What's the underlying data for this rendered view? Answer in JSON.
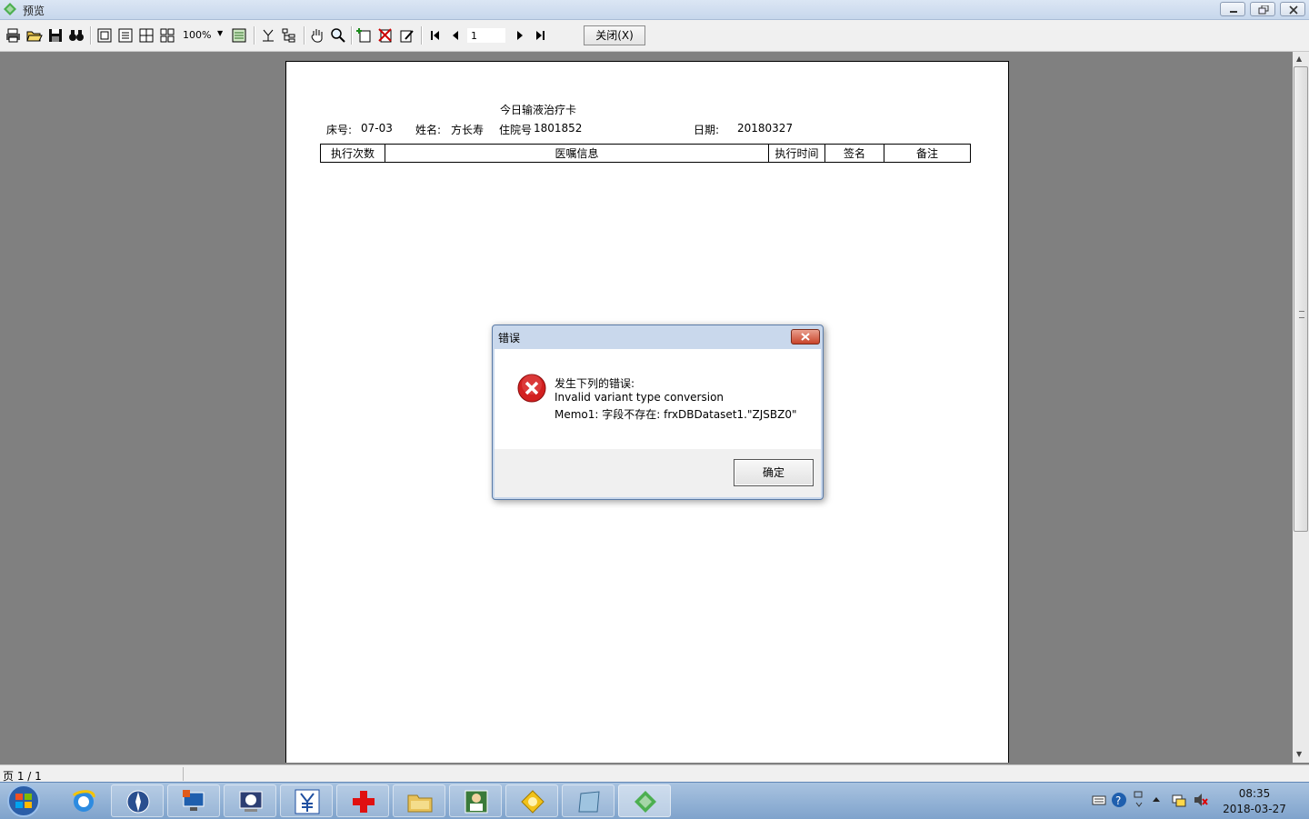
{
  "window": {
    "title": "预览"
  },
  "toolbar": {
    "zoom": "100%",
    "page_value": "1",
    "close_label": "关闭(X)"
  },
  "report": {
    "title": "今日输液治疗卡",
    "bed_label": "床号:",
    "bed_value": "07-03",
    "name_label": "姓名:",
    "name_value": "方长寿",
    "inpatient_label": "住院号",
    "inpatient_value": "1801852",
    "date_label": "日期:",
    "date_value": "20180327",
    "columns": [
      "执行次数",
      "医嘱信息",
      "执行时间",
      "签名",
      "备注"
    ]
  },
  "status": {
    "page": "页 1 / 1"
  },
  "dialog": {
    "title": "错误",
    "line1": "发生下列的错误:",
    "line2": "Invalid variant type conversion",
    "line3": "Memo1: 字段不存在: frxDBDataset1.\"ZJSBZ0\"",
    "ok_label": "确定"
  },
  "taskbar": {
    "time": "08:35",
    "date": "2018-03-27"
  },
  "colors": {
    "page_bg": "#808080",
    "error_red": "#d22020",
    "taskbar": "#8fb0d6"
  }
}
